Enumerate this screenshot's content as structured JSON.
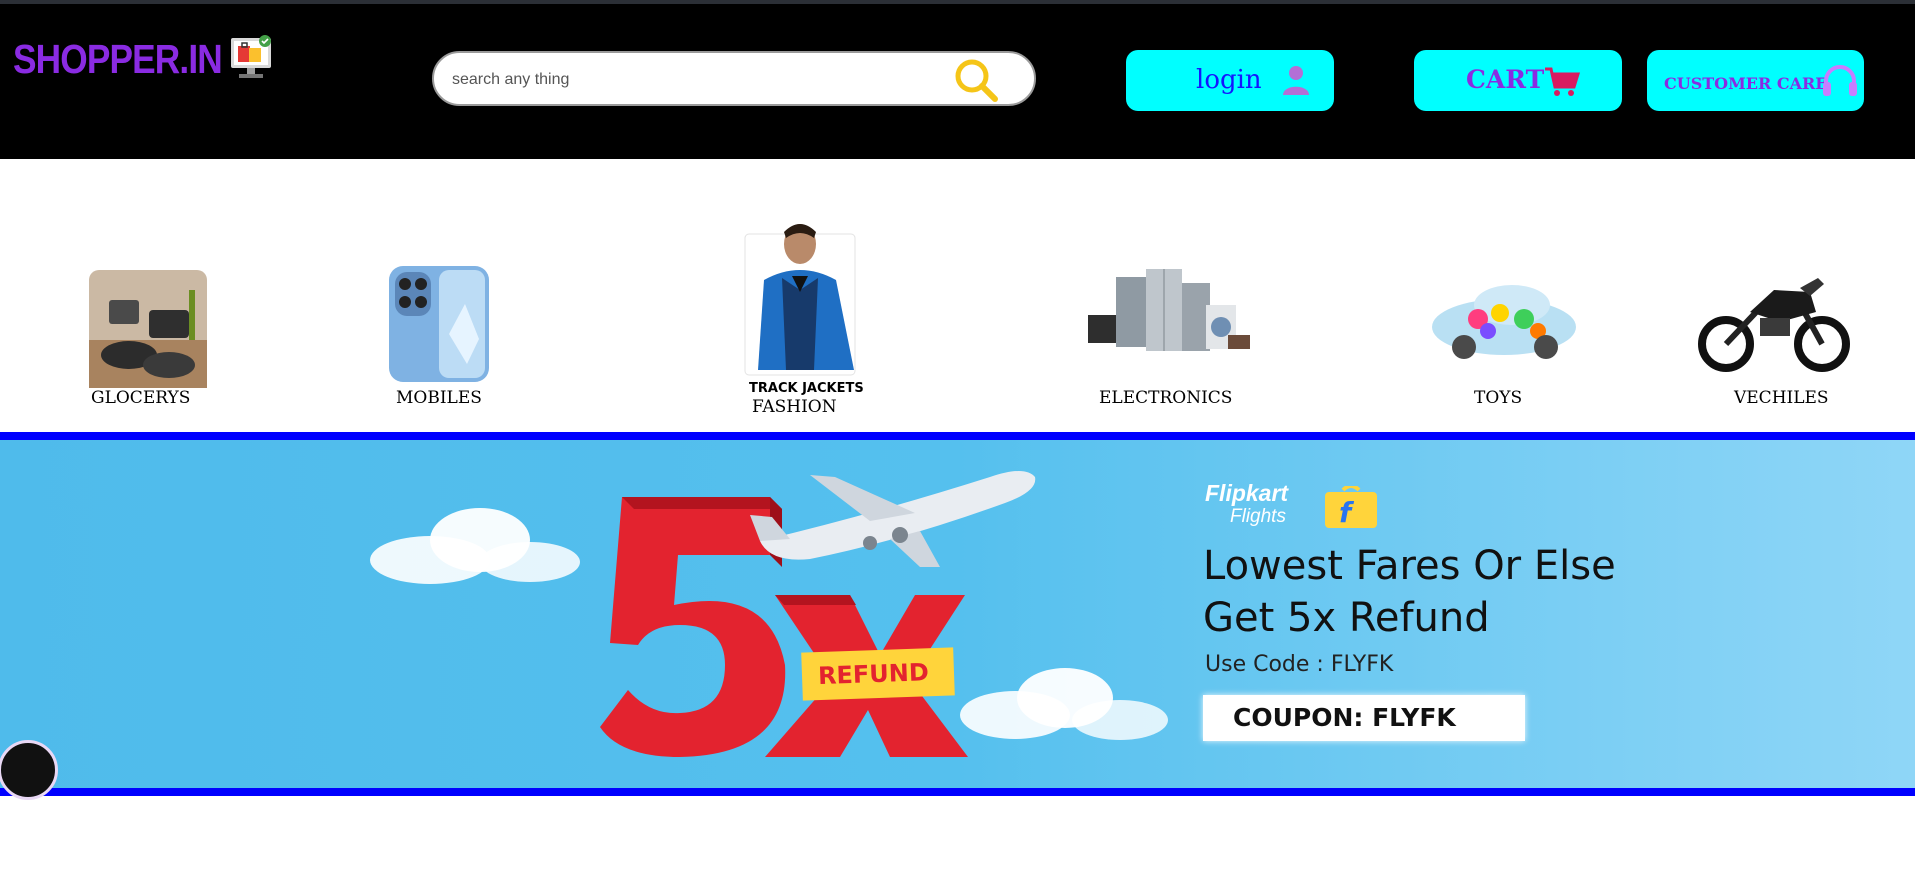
{
  "brand": {
    "name": "SHOPPER.IN",
    "logo_icon": "shopping-monitor-icon"
  },
  "search": {
    "placeholder": "search any thing",
    "icon": "search-icon"
  },
  "header_buttons": {
    "login_label": "login",
    "cart_label": "CART",
    "customer_care_label": "CUSTOMER CARE"
  },
  "categories": [
    {
      "label": "GLOCERYS",
      "icon": "cookware-thumb"
    },
    {
      "label": "MOBILES",
      "icon": "phone-thumb"
    },
    {
      "label": "FASHION",
      "icon": "jacket-thumb",
      "thumb_caption": "TRACK JACKETS"
    },
    {
      "label": "ELECTRONICS",
      "icon": "appliances-thumb"
    },
    {
      "label": "TOYS",
      "icon": "toy-car-thumb"
    },
    {
      "label": "VECHILES",
      "icon": "motorcycle-thumb"
    }
  ],
  "banner": {
    "brand_line1": "Flipkart",
    "brand_line2": "Flights",
    "big_number": "5X",
    "refund_tag": "REFUND",
    "headline_line1": "Lowest Fares Or Else",
    "headline_line2": "Get 5x Refund",
    "use_code": "Use Code : FLYFK",
    "coupon": "COUPON: FLYFK"
  },
  "colors": {
    "header_bg": "#000000",
    "brand": "#8a2be2",
    "pill_bg": "#00ffff",
    "login_text": "#1515ff",
    "banner_border": "#0000ff",
    "banner_bg": "#55c0ee",
    "search_icon": "#f5c518",
    "cart_icon": "#d81b60"
  }
}
